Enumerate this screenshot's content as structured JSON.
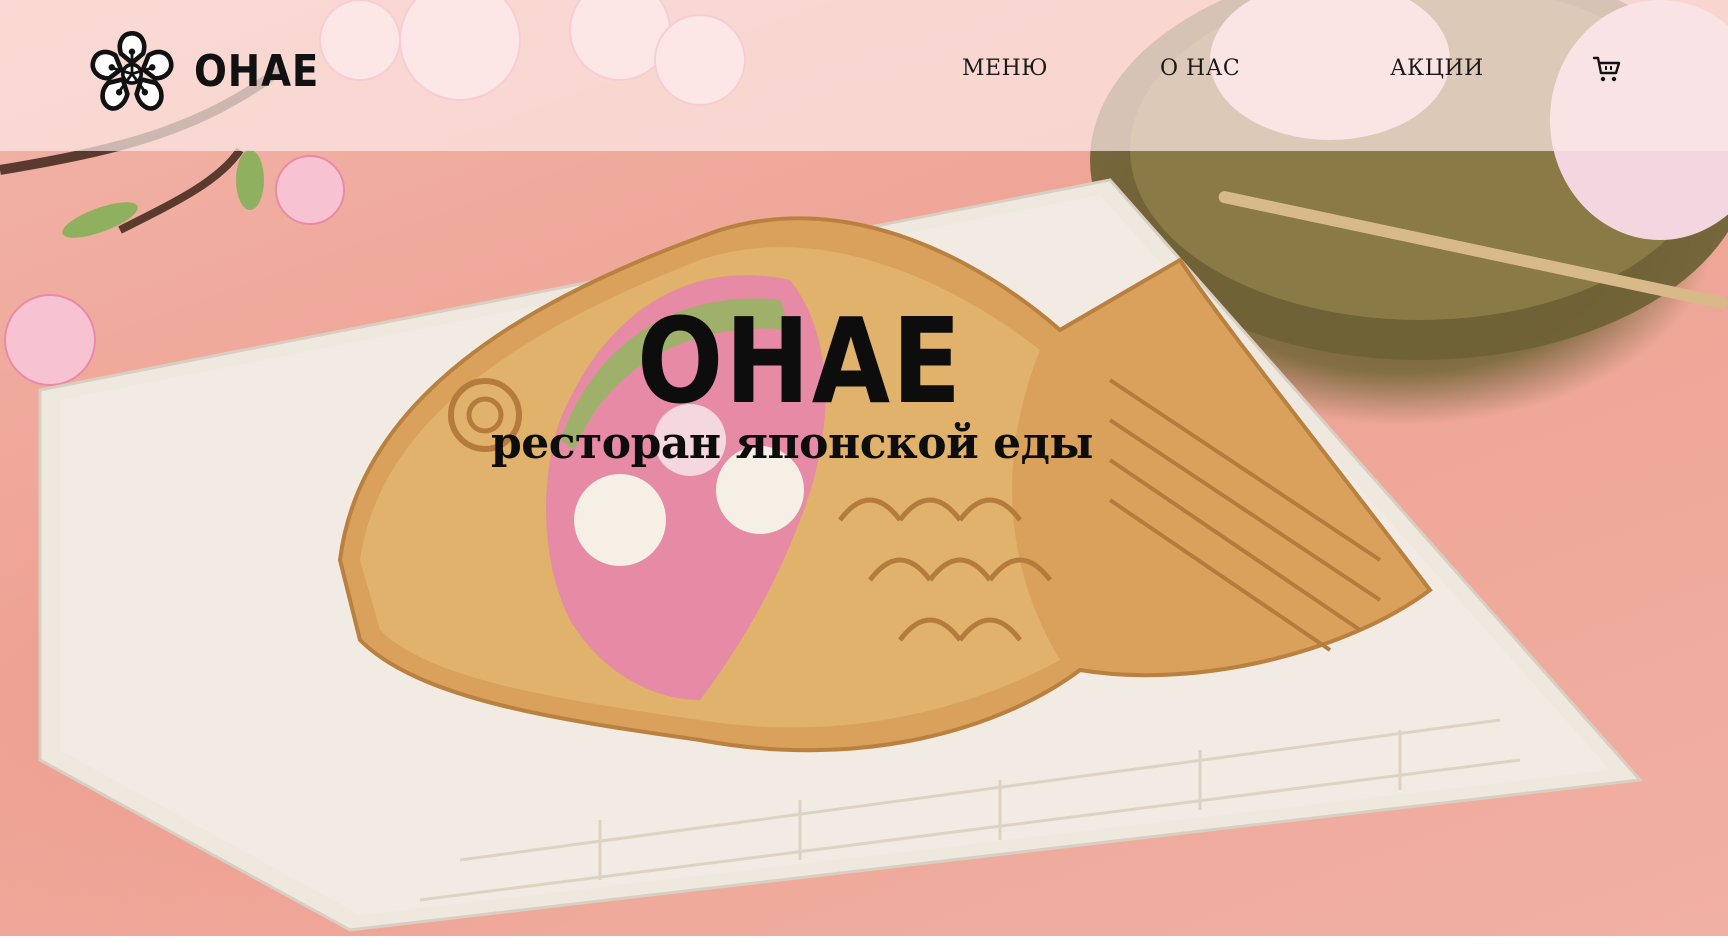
{
  "header": {
    "brand": "OHAE",
    "logo_icon": "sakura-flower-icon",
    "nav": [
      {
        "label": "МЕНЮ"
      },
      {
        "label": "О НАС"
      },
      {
        "label": "АКЦИИ"
      }
    ],
    "cart_icon": "shopping-cart-icon"
  },
  "hero": {
    "title": "OHAE",
    "subtitle": "ресторан японской еды",
    "image": "taiyaki-on-plate"
  },
  "colors": {
    "header_bg": "#fce8e4",
    "text": "#111111",
    "background_pink": "#efa698",
    "plate": "#efe8df",
    "taiyaki": "#d9a760"
  }
}
